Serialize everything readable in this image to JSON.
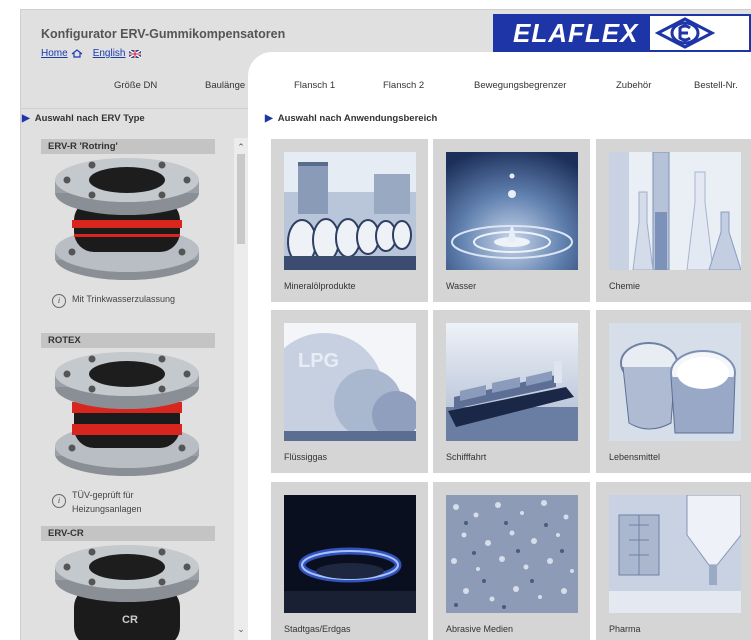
{
  "header": {
    "app_title": "Konfigurator ERV-Gummikompensatoren",
    "home_link": "Home",
    "english_link": "English",
    "logo_text": "ELAFLEX"
  },
  "nav": {
    "items": [
      "Größe DN",
      "Baulänge",
      "Flansch 1",
      "Flansch 2",
      "Bewegungsbegrenzer",
      "Zubehör",
      "Bestell-Nr."
    ]
  },
  "sidebar": {
    "heading": "Auswahl nach ERV Type",
    "types": [
      {
        "name": "ERV-R 'Rotring'",
        "note": "Mit Trinkwasserzulassung"
      },
      {
        "name": "ROTEX",
        "note": "TÜV-geprüft für Heizungsanlagen"
      },
      {
        "name": "ERV-CR",
        "note": ""
      }
    ]
  },
  "main": {
    "heading": "Auswahl nach Anwendungsbereich",
    "tiles": [
      {
        "label": "Mineralölprodukte"
      },
      {
        "label": "Wasser"
      },
      {
        "label": "Chemie"
      },
      {
        "label": "Flüssiggas"
      },
      {
        "label": "Schifffahrt"
      },
      {
        "label": "Lebensmittel"
      },
      {
        "label": "Stadtgas/Erdgas"
      },
      {
        "label": "Abrasive Medien"
      },
      {
        "label": "Pharma"
      }
    ]
  },
  "colors": {
    "brand_blue": "#1d35a6",
    "tile_bg": "#d5d5d5",
    "sidebar_bg": "#e0e0e0",
    "rotring_red": "#d8261e"
  }
}
